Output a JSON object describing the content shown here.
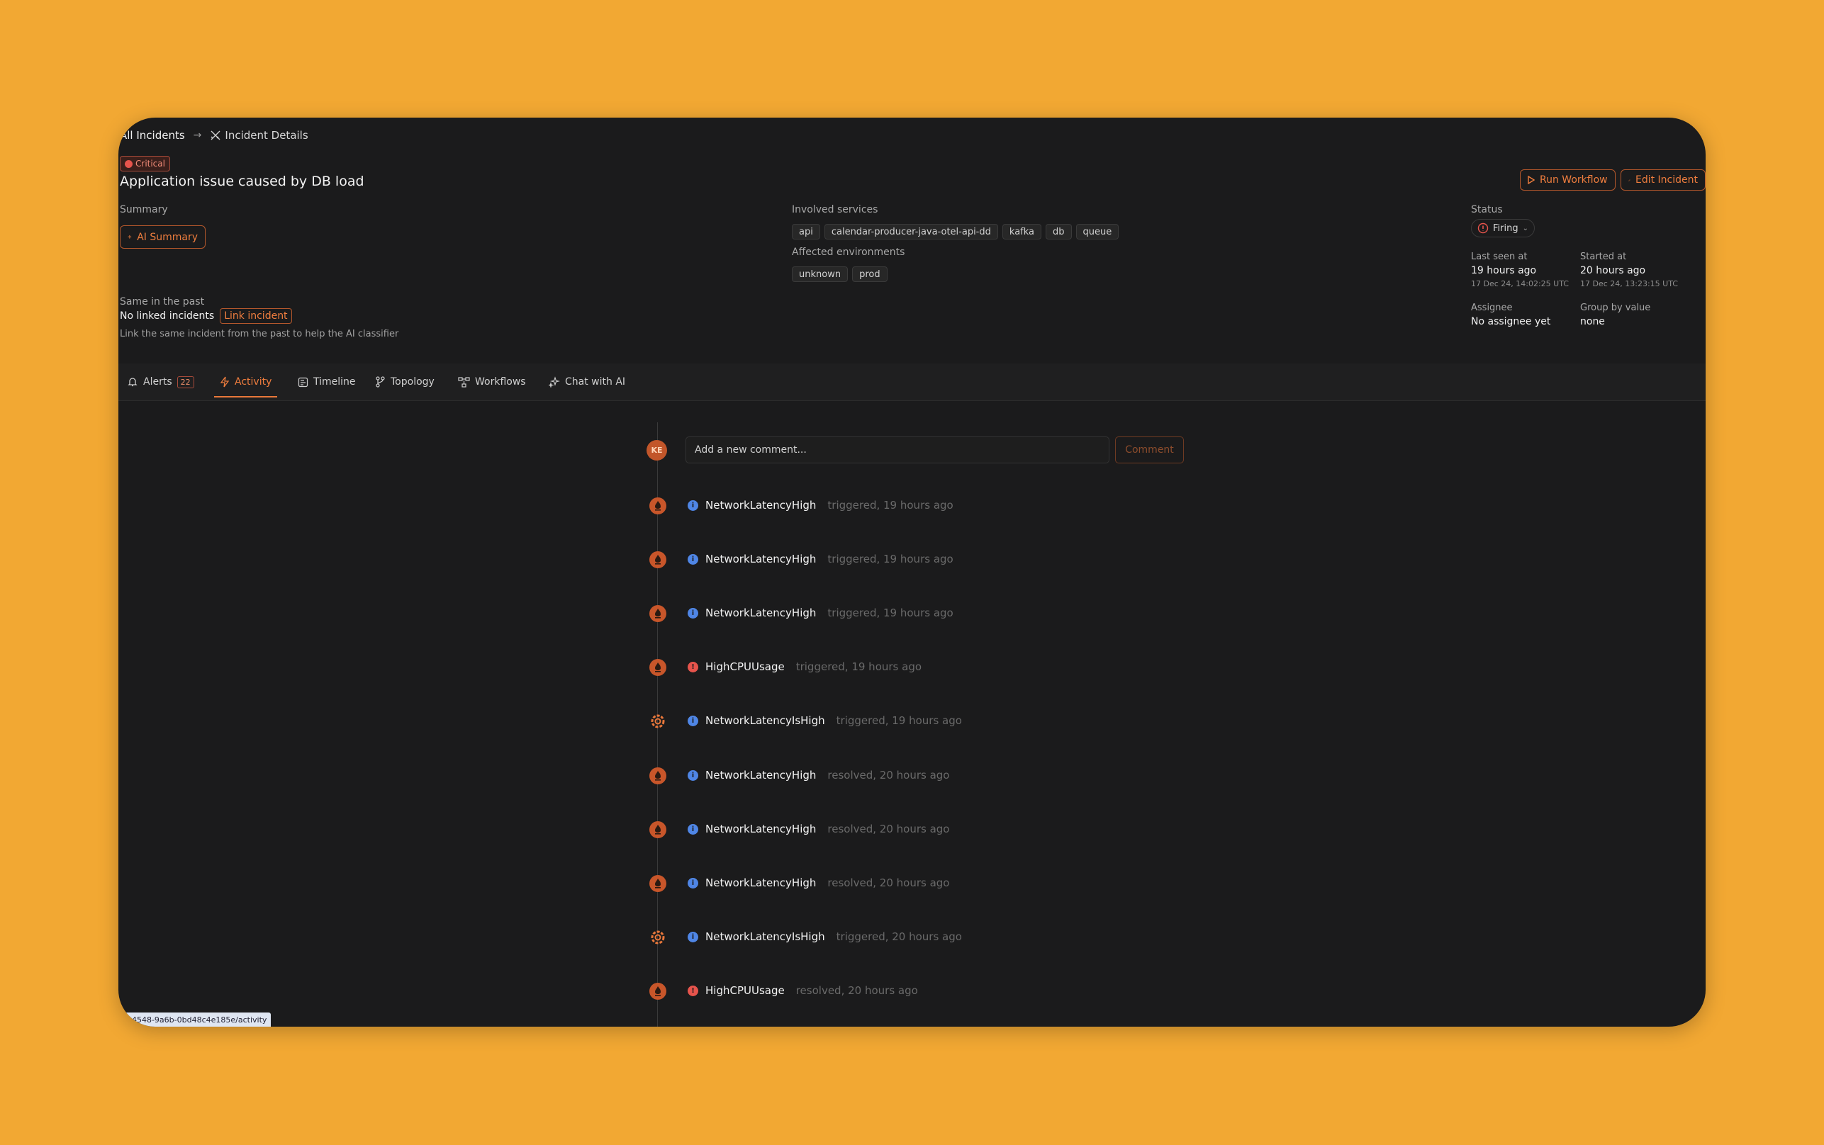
{
  "breadcrumb": {
    "home": "All Incidents",
    "current": "Incident Details"
  },
  "incident": {
    "severity": "Critical",
    "title": "Application issue caused by DB load",
    "run_workflow_label": "Run Workflow",
    "edit_label": "Edit Incident"
  },
  "summary": {
    "label": "Summary",
    "ai_button": "AI Summary"
  },
  "services": {
    "label": "Involved services",
    "items": [
      "api",
      "calendar-producer-java-otel-api-dd",
      "kafka",
      "db",
      "queue"
    ]
  },
  "environments": {
    "label": "Affected environments",
    "items": [
      "unknown",
      "prod"
    ]
  },
  "past": {
    "label": "Same in the past",
    "value": "No linked incidents",
    "link_button": "Link incident",
    "hint": "Link the same incident from the past to help the AI classifier"
  },
  "status": {
    "label": "Status",
    "value": "Firing"
  },
  "last_seen": {
    "label": "Last seen at",
    "value": "19 hours ago",
    "date": "17 Dec 24, 14:02:25 UTC"
  },
  "started": {
    "label": "Started at",
    "value": "20 hours ago",
    "date": "17 Dec 24, 13:23:15 UTC"
  },
  "assignee": {
    "label": "Assignee",
    "value": "No assignee yet"
  },
  "group_by": {
    "label": "Group by value",
    "value": "none"
  },
  "tabs": [
    {
      "label": "Alerts",
      "count": "22"
    },
    {
      "label": "Activity"
    },
    {
      "label": "Timeline"
    },
    {
      "label": "Topology"
    },
    {
      "label": "Workflows"
    },
    {
      "label": "Chat with AI"
    }
  ],
  "comment": {
    "avatar": "KE",
    "placeholder": "Add a new comment...",
    "button": "Comment"
  },
  "activity": [
    {
      "name": "NetworkLatencyHigh",
      "status": "triggered, 19 hours ago",
      "severity": "info",
      "source": "prometheus-icon"
    },
    {
      "name": "NetworkLatencyHigh",
      "status": "triggered, 19 hours ago",
      "severity": "info",
      "source": "prometheus-icon"
    },
    {
      "name": "NetworkLatencyHigh",
      "status": "triggered, 19 hours ago",
      "severity": "info",
      "source": "prometheus-icon"
    },
    {
      "name": "HighCPUUsage",
      "status": "triggered, 19 hours ago",
      "severity": "critical",
      "source": "prometheus-icon"
    },
    {
      "name": "NetworkLatencyIsHigh",
      "status": "triggered, 19 hours ago",
      "severity": "info",
      "source": "grafana-icon"
    },
    {
      "name": "NetworkLatencyHigh",
      "status": "resolved, 20 hours ago",
      "severity": "info",
      "source": "prometheus-icon"
    },
    {
      "name": "NetworkLatencyHigh",
      "status": "resolved, 20 hours ago",
      "severity": "info",
      "source": "prometheus-icon"
    },
    {
      "name": "NetworkLatencyHigh",
      "status": "resolved, 20 hours ago",
      "severity": "info",
      "source": "prometheus-icon"
    },
    {
      "name": "NetworkLatencyIsHigh",
      "status": "triggered, 20 hours ago",
      "severity": "info",
      "source": "grafana-icon"
    },
    {
      "name": "HighCPUUsage",
      "status": "resolved, 20 hours ago",
      "severity": "critical",
      "source": "prometheus-icon"
    }
  ],
  "status_url": "8-4548-9a6b-0bd48c4e185e/activity",
  "colors": {
    "background": "#F2A833",
    "panel": "#1b1b1c",
    "accent": "#e8773a",
    "info": "#4f86e6",
    "critical": "#e7544c"
  }
}
